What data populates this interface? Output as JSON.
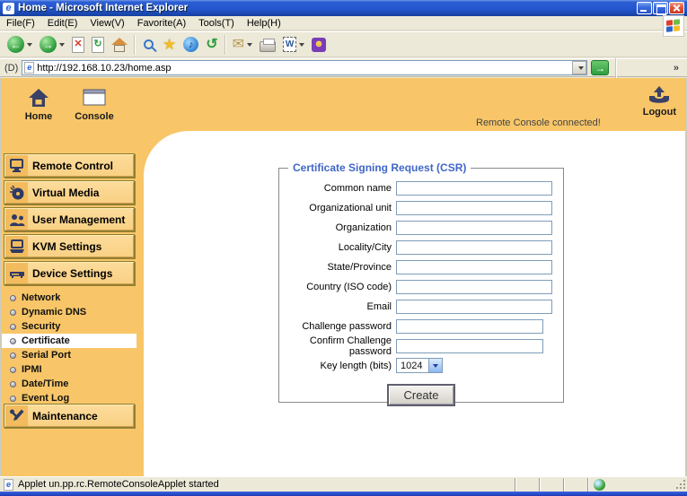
{
  "window": {
    "title": "Home - Microsoft Internet Explorer"
  },
  "menu": {
    "items": [
      "File(F)",
      "Edit(E)",
      "View(V)",
      "Favorite(A)",
      "Tools(T)",
      "Help(H)"
    ]
  },
  "address": {
    "label": "(D)",
    "url": "http://192.168.10.23/home.asp",
    "links_chevron": "»"
  },
  "icons": {
    "ie": "e",
    "back": "←",
    "forward": "→",
    "stop": "✕",
    "refresh": "↻",
    "media_note": "♪",
    "history": "↺",
    "mail": "✉",
    "word": "W",
    "smiley": "☻",
    "star": "★",
    "go": "→"
  },
  "banner": {
    "home": "Home",
    "console": "Console",
    "status": "Remote Console connected!",
    "logout": "Logout"
  },
  "sidebar": {
    "buttons": [
      {
        "label": "Remote Control"
      },
      {
        "label": "Virtual Media"
      },
      {
        "label": "User Management"
      },
      {
        "label": "KVM Settings"
      },
      {
        "label": "Device Settings"
      }
    ],
    "submenu": [
      {
        "label": "Network",
        "selected": false
      },
      {
        "label": "Dynamic DNS",
        "selected": false
      },
      {
        "label": "Security",
        "selected": false
      },
      {
        "label": "Certificate",
        "selected": true
      },
      {
        "label": "Serial Port",
        "selected": false
      },
      {
        "label": "IPMI",
        "selected": false
      },
      {
        "label": "Date/Time",
        "selected": false
      },
      {
        "label": "Event Log",
        "selected": false
      }
    ],
    "maintenance": "Maintenance"
  },
  "form": {
    "legend": "Certificate Signing Request (CSR)",
    "fields": [
      {
        "label": "Common name",
        "value": ""
      },
      {
        "label": "Organizational unit",
        "value": ""
      },
      {
        "label": "Organization",
        "value": ""
      },
      {
        "label": "Locality/City",
        "value": ""
      },
      {
        "label": "State/Province",
        "value": ""
      },
      {
        "label": "Country (ISO code)",
        "value": ""
      },
      {
        "label": "Email",
        "value": ""
      },
      {
        "label": "Challenge password",
        "value": ""
      },
      {
        "label": "Confirm Challenge password",
        "value": ""
      }
    ],
    "key_length": {
      "label": "Key length (bits)",
      "value": "1024"
    },
    "create_label": "Create"
  },
  "statusbar": {
    "text": "Applet un.pp.rc.RemoteConsoleApplet started"
  },
  "colors": {
    "banner_orange": "#F8C668",
    "button_tan": "#F9D083",
    "legend_blue": "#4066C8",
    "input_border": "#7F9DB9"
  }
}
